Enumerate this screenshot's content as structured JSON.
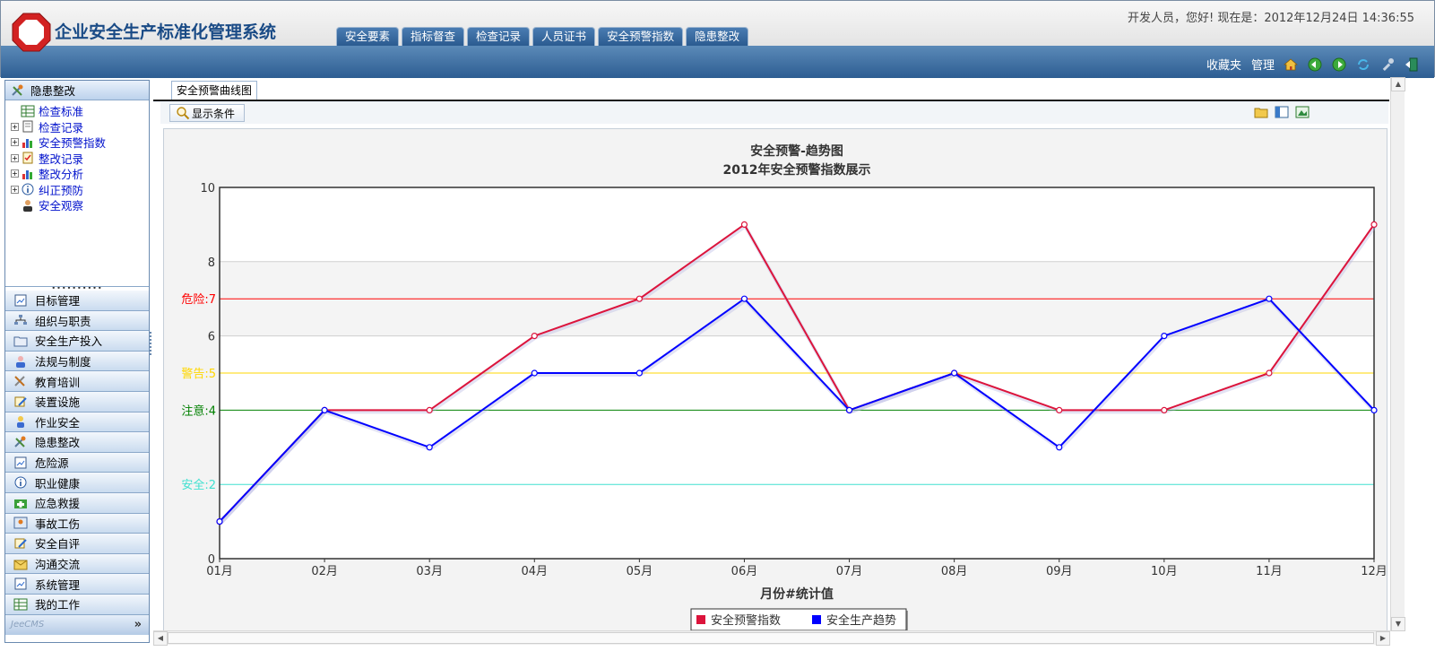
{
  "app": {
    "title": "企业安全生产标准化管理系统",
    "welcome": "开发人员，您好! 现在是：2012年12月24日 14:36:55"
  },
  "main_tabs": [
    "安全要素",
    "指标督查",
    "检查记录",
    "人员证书",
    "安全预警指数",
    "隐患整改"
  ],
  "toolbar": {
    "favorites": "收藏夹",
    "manage": "管理"
  },
  "sidebar": {
    "section_title": "隐患整改",
    "tree": [
      {
        "label": "检查标准",
        "expandable": false,
        "icon": "table-icon"
      },
      {
        "label": "检查记录",
        "expandable": true,
        "icon": "document-icon"
      },
      {
        "label": "安全预警指数",
        "expandable": true,
        "icon": "bar-chart-icon"
      },
      {
        "label": "整改记录",
        "expandable": true,
        "icon": "checklist-icon"
      },
      {
        "label": "整改分析",
        "expandable": true,
        "icon": "bar-chart-icon"
      },
      {
        "label": "纠正预防",
        "expandable": true,
        "icon": "info-icon"
      },
      {
        "label": "安全观察",
        "expandable": false,
        "icon": "person-icon"
      }
    ],
    "menu": [
      {
        "label": "目标管理",
        "icon": "chart-doc-icon"
      },
      {
        "label": "组织与职责",
        "icon": "org-icon"
      },
      {
        "label": "安全生产投入",
        "icon": "folder-icon"
      },
      {
        "label": "法规与制度",
        "icon": "user-icon"
      },
      {
        "label": "教育培训",
        "icon": "tools-icon"
      },
      {
        "label": "装置设施",
        "icon": "edit-icon"
      },
      {
        "label": "作业安全",
        "icon": "worker-icon"
      },
      {
        "label": "隐患整改",
        "icon": "wrench-icon"
      },
      {
        "label": "危险源",
        "icon": "chart-doc-icon"
      },
      {
        "label": "职业健康",
        "icon": "info-icon"
      },
      {
        "label": "应急救援",
        "icon": "rescue-icon"
      },
      {
        "label": "事故工伤",
        "icon": "injury-icon"
      },
      {
        "label": "安全自评",
        "icon": "edit-icon"
      },
      {
        "label": "沟通交流",
        "icon": "mail-icon"
      },
      {
        "label": "系统管理",
        "icon": "chart-doc-icon"
      },
      {
        "label": "我的工作",
        "icon": "table-icon"
      }
    ],
    "footer_brand": "JeeCMS",
    "footer_more": "»"
  },
  "content": {
    "tab_label": "安全预警曲线图",
    "condition_button": "显示条件"
  },
  "colors": {
    "series_warning_index": "#dc143c",
    "series_trend": "#0000ff",
    "danger": "#ff0000",
    "warning": "#ffd700",
    "attention": "#008000",
    "safe": "#40e0d0"
  },
  "chart_data": {
    "type": "line",
    "title": "安全预警-趋势图",
    "subtitle": "2012年安全预警指数展示",
    "xlabel": "月份#统计值",
    "ylabel": "",
    "categories": [
      "01月",
      "02月",
      "03月",
      "04月",
      "05月",
      "06月",
      "07月",
      "08月",
      "09月",
      "10月",
      "11月",
      "12月"
    ],
    "ylim": [
      0,
      10
    ],
    "yticks": [
      0,
      6,
      8,
      10
    ],
    "series": [
      {
        "name": "安全预警指数",
        "color": "#dc143c",
        "values": [
          1,
          4,
          4,
          6,
          7,
          9,
          4,
          5,
          4,
          4,
          5,
          9
        ]
      },
      {
        "name": "安全生产趋势",
        "color": "#0000ff",
        "values": [
          1,
          4,
          3,
          5,
          5,
          7,
          4,
          5,
          3,
          6,
          7,
          4
        ]
      }
    ],
    "thresholds": [
      {
        "label": "危险:7",
        "value": 7,
        "color": "#ff0000"
      },
      {
        "label": "警告:5",
        "value": 5,
        "color": "#ffd700"
      },
      {
        "label": "注意:4",
        "value": 4,
        "color": "#008000"
      },
      {
        "label": "安全:2",
        "value": 2,
        "color": "#40e0d0"
      }
    ],
    "grid": true,
    "legend_position": "bottom"
  }
}
